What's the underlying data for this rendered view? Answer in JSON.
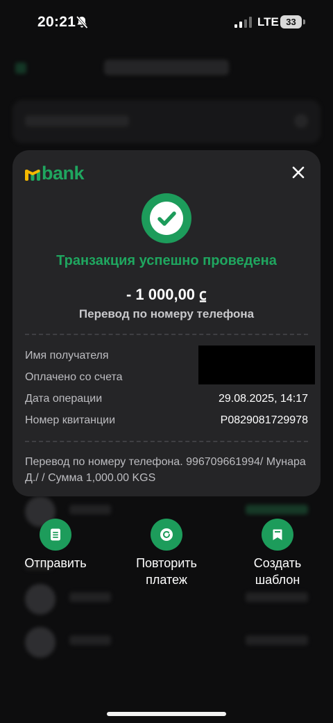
{
  "status_bar": {
    "time": "20:21",
    "network": "LTE",
    "battery": "33",
    "icons": [
      "bell-slash-icon",
      "signal-icon",
      "battery-icon"
    ]
  },
  "receipt": {
    "brand": "bank",
    "brand_color": "#1fa65f",
    "accent_yellow": "#f5b800",
    "status_title": "Транзакция успешно проведена",
    "amount": "- 1 000,00 ⃀",
    "operation_type": "Перевод по номеру телефона",
    "details": [
      {
        "label": "Имя получателя",
        "value": ""
      },
      {
        "label": "Оплачено со счета",
        "value": ""
      },
      {
        "label": "Дата операции",
        "value": "29.08.2025, 14:17"
      },
      {
        "label": "Номер квитанции",
        "value": "P0829081729978"
      }
    ],
    "comment": "Перевод по номеру телефона. 996709661994/ Мунара Д./  / Сумма 1,000.00 KGS"
  },
  "actions": [
    {
      "label": "Отправить",
      "icon": "document-list-icon"
    },
    {
      "label": "Повторить\nплатеж",
      "icon": "repeat-icon"
    },
    {
      "label": "Создать\nшаблон",
      "icon": "bookmark-icon"
    }
  ]
}
